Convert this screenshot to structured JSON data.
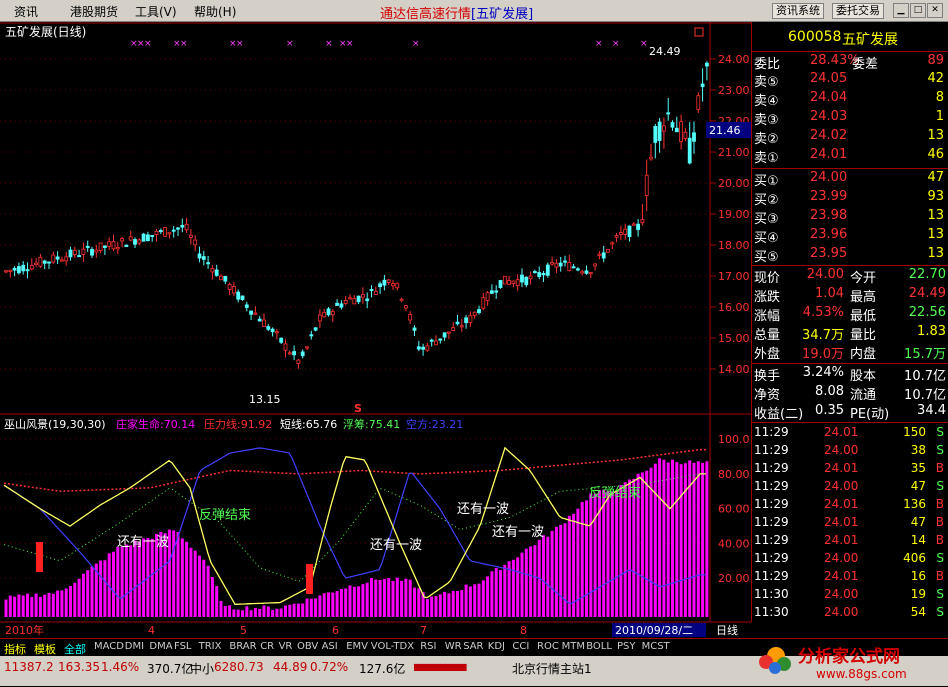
{
  "menu": [
    "资讯",
    "港股期货",
    "工具(V)",
    "帮助(H)"
  ],
  "app_title": "通达信高速行情",
  "stock_tag": "[五矿发展]",
  "top_buttons": [
    "资讯系统",
    "委托交易"
  ],
  "chart_title": "五矿发展(日线)",
  "price_axis": [
    "24.00",
    "23.00",
    "22.00",
    "21.00",
    "20.00",
    "19.00",
    "18.00",
    "17.00",
    "16.00",
    "15.00",
    "14.00"
  ],
  "current_price_label": "21.46",
  "hi_label": "24.49",
  "lo_label": "13.15",
  "s_marker": "S",
  "indicator": {
    "title": "巫山风景(19,30,30)",
    "lines": [
      {
        "label": "庄家生命:70.14",
        "color": "#ff00ff"
      },
      {
        "label": "压力线:91.92",
        "color": "#ff3030"
      },
      {
        "label": "短线:65.76",
        "color": "#ffffff"
      },
      {
        "label": "浮筹:75.41",
        "color": "#50ff50"
      },
      {
        "label": "空方:23.21",
        "color": "#4040ff"
      }
    ],
    "axis": [
      "100.0",
      "80.00",
      "60.00",
      "40.00",
      "20.00"
    ],
    "notes": [
      "还有一波",
      "反弹结束",
      "还有一波",
      "还有一波",
      "还有一波",
      "反弹结束"
    ]
  },
  "x_labels": [
    "2010年",
    "4",
    "5",
    "6",
    "7",
    "8"
  ],
  "date_box": "2010/09/28/二",
  "period": "日线",
  "quote": {
    "code": "600058",
    "name": "五矿发展",
    "weibi_label": "委比",
    "weibi": "28.43%",
    "weicha_label": "委差",
    "weicha": "89",
    "asks": [
      {
        "label": "卖⑤",
        "price": "24.05",
        "vol": "42"
      },
      {
        "label": "卖④",
        "price": "24.04",
        "vol": "8"
      },
      {
        "label": "卖③",
        "price": "24.03",
        "vol": "1"
      },
      {
        "label": "卖②",
        "price": "24.02",
        "vol": "13"
      },
      {
        "label": "卖①",
        "price": "24.01",
        "vol": "46"
      }
    ],
    "bids": [
      {
        "label": "买①",
        "price": "24.00",
        "vol": "47"
      },
      {
        "label": "买②",
        "price": "23.99",
        "vol": "93"
      },
      {
        "label": "买③",
        "price": "23.98",
        "vol": "13"
      },
      {
        "label": "买④",
        "price": "23.96",
        "vol": "13"
      },
      {
        "label": "买⑤",
        "price": "23.95",
        "vol": "13"
      }
    ],
    "stats": [
      {
        "l1": "现价",
        "v1": "24.00",
        "l2": "今开",
        "v2": "22.70"
      },
      {
        "l1": "涨跌",
        "v1": "1.04",
        "l2": "最高",
        "v2": "24.49"
      },
      {
        "l1": "涨幅",
        "v1": "4.53%",
        "l2": "最低",
        "v2": "22.56"
      },
      {
        "l1": "总量",
        "v1": "34.7万",
        "l2": "量比",
        "v2": "1.83"
      },
      {
        "l1": "外盘",
        "v1": "19.0万",
        "l2": "内盘",
        "v2": "15.7万"
      }
    ],
    "stats2": [
      {
        "l1": "换手",
        "v1": "3.24%",
        "l2": "股本",
        "v2": "10.7亿"
      },
      {
        "l1": "净资",
        "v1": "8.08",
        "l2": "流通",
        "v2": "10.7亿"
      },
      {
        "l1": "收益(二)",
        "v1": "0.35",
        "l2": "PE(动)",
        "v2": "34.4"
      }
    ],
    "ticks": [
      {
        "t": "11:29",
        "p": "24.01",
        "v": "150",
        "d": "S"
      },
      {
        "t": "11:29",
        "p": "24.00",
        "v": "38",
        "d": "S"
      },
      {
        "t": "11:29",
        "p": "24.01",
        "v": "35",
        "d": "B"
      },
      {
        "t": "11:29",
        "p": "24.00",
        "v": "47",
        "d": "S"
      },
      {
        "t": "11:29",
        "p": "24.01",
        "v": "136",
        "d": "B"
      },
      {
        "t": "11:29",
        "p": "24.01",
        "v": "47",
        "d": "B"
      },
      {
        "t": "11:29",
        "p": "24.01",
        "v": "14",
        "d": "B"
      },
      {
        "t": "11:29",
        "p": "24.00",
        "v": "406",
        "d": "S"
      },
      {
        "t": "11:29",
        "p": "24.01",
        "v": "16",
        "d": "B"
      },
      {
        "t": "11:30",
        "p": "24.00",
        "v": "19",
        "d": "S"
      },
      {
        "t": "11:30",
        "p": "24.00",
        "v": "54",
        "d": "S"
      }
    ]
  },
  "tabs": [
    "指标",
    "模板",
    "全部",
    "MACD",
    "DMI",
    "DMA",
    "FSL",
    "TRIX",
    "BRAR",
    "CR",
    "VR",
    "OBV",
    "ASI",
    "EMV",
    "VOL-TDX",
    "RSI",
    "WR",
    "SAR",
    "KDJ",
    "CCI",
    "ROC",
    "MTM",
    "BOLL",
    "PSY",
    "MCST"
  ],
  "status": {
    "sh_index": "11387.2",
    "sh_chg": "163.35",
    "sh_pct": "1.46%",
    "sh_amt": "370.7亿",
    "sz_label": "中小",
    "sz_index": "6280.73",
    "sz_chg": "44.89",
    "sz_pct": "0.72%",
    "sz_amt": "127.6亿",
    "server": "北京行情主站1"
  },
  "logo": {
    "cn": "分析家公式网",
    "url": "www.88gs.com"
  },
  "colors": {
    "up": "#ff3232",
    "down": "#54ffff",
    "magenta": "#ff00ff",
    "yellow": "#ffff00"
  }
}
